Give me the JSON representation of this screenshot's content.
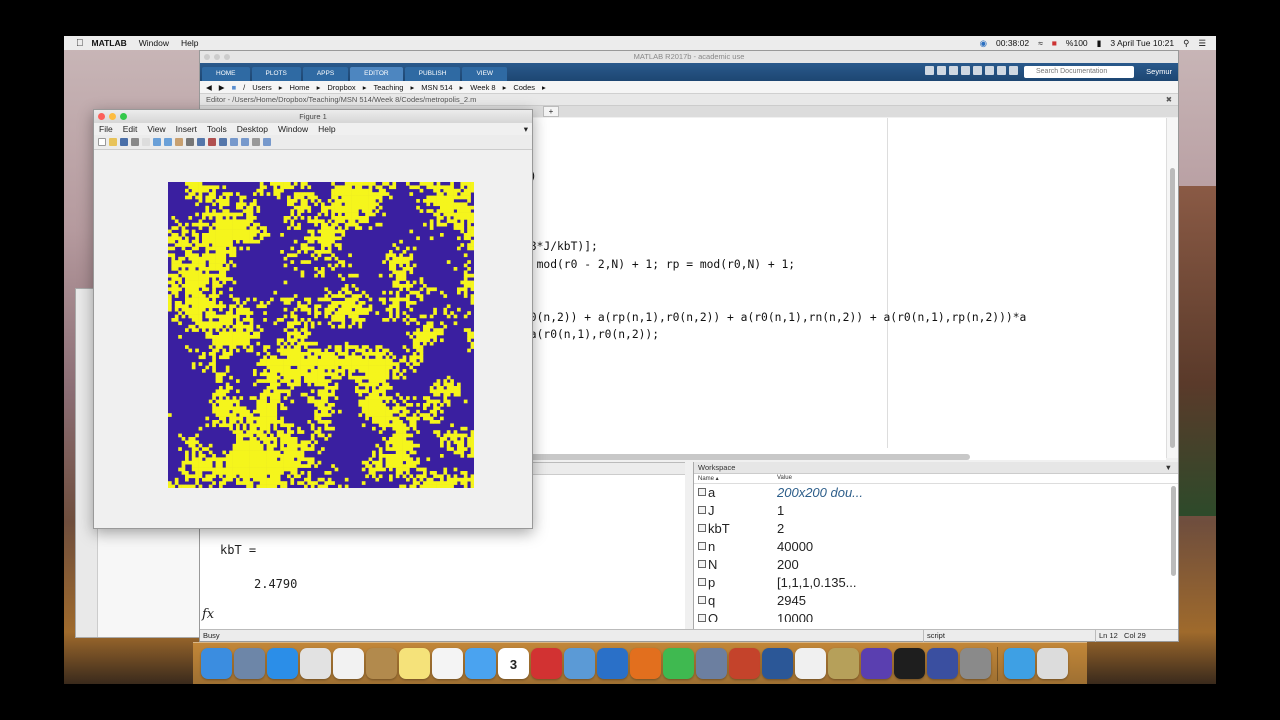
{
  "menubar": {
    "apple": "",
    "items": [
      "MATLAB",
      "Window",
      "Help"
    ],
    "timer": "00:38:02",
    "battery": "%100",
    "datetime": "3 April Tue  10:21"
  },
  "matlab": {
    "title": "MATLAB R2017b - academic use",
    "tabs": [
      "HOME",
      "PLOTS",
      "APPS",
      "EDITOR",
      "PUBLISH",
      "VIEW"
    ],
    "active_tab": "EDITOR",
    "search_placeholder": "Search Documentation",
    "user": "Seymur",
    "path": [
      "/",
      "Users",
      "Home",
      "Dropbox",
      "Teaching",
      "MSN 514",
      "Week 8",
      "Codes"
    ],
    "editor_header": "Editor - /Users/Home/Dropbox/Teaching/MSN 514/Week 8/Codes/metropolis_2.m",
    "code_lines": [
      {
        "text": "x)"
      },
      {
        "text": "-8*J/kbT)];"
      },
      {
        "text": "= mod(r0 - 2,N) + 1; rp = mod(r0,N) + 1;"
      },
      {
        "text": "r0(n,2)) + a(rp(n,1),r0(n,2)) + a(r0(n,1),rn(n,2)) + a(r0(n,1),rp(n,2)))*a"
      },
      {
        "text": "-a(r0(n,1),r0(n,2));"
      }
    ],
    "command": {
      "kbt_label": "kbT =",
      "kbt_value": "2.4790",
      "fx": "fx"
    },
    "workspace": {
      "title": "Workspace",
      "col_name": "Name ▴",
      "col_value": "Value",
      "rows": [
        {
          "name": "a",
          "value": "200x200 dou..."
        },
        {
          "name": "J",
          "value": "1"
        },
        {
          "name": "kbT",
          "value": "2"
        },
        {
          "name": "n",
          "value": "40000"
        },
        {
          "name": "N",
          "value": "200"
        },
        {
          "name": "p",
          "value": "[1,1,1,0.135..."
        },
        {
          "name": "q",
          "value": "2945"
        },
        {
          "name": "Q",
          "value": "10000"
        }
      ]
    },
    "status": {
      "busy": "Busy",
      "mode": "script",
      "ln_label": "Ln",
      "ln": "12",
      "col_label": "Col",
      "col": "29"
    }
  },
  "figure": {
    "title": "Figure 1",
    "menu": [
      "File",
      "Edit",
      "View",
      "Insert",
      "Tools",
      "Desktop",
      "Window",
      "Help"
    ],
    "colors": {
      "spin_down": "#3a1fa0",
      "spin_up": "#f5f51c"
    },
    "lattice_size": 200
  },
  "dock": {
    "icons": [
      "finder-icon",
      "photos-icon",
      "safari-icon",
      "chrome-icon",
      "itunes-icon",
      "book-icon",
      "notes-icon",
      "reminders-icon",
      "messages-icon",
      "calendar-icon",
      "opera-icon",
      "keynote-icon",
      "quicktime-icon",
      "matlab-icon",
      "facetime-icon",
      "preview-icon",
      "powerpoint-icon",
      "word-icon",
      "pages-icon",
      "transmit-icon",
      "mendeley-icon",
      "terminal-icon",
      "texmaker-icon",
      "settings-icon",
      "folder-icon",
      "trash-icon"
    ],
    "calendar_day": "3"
  }
}
